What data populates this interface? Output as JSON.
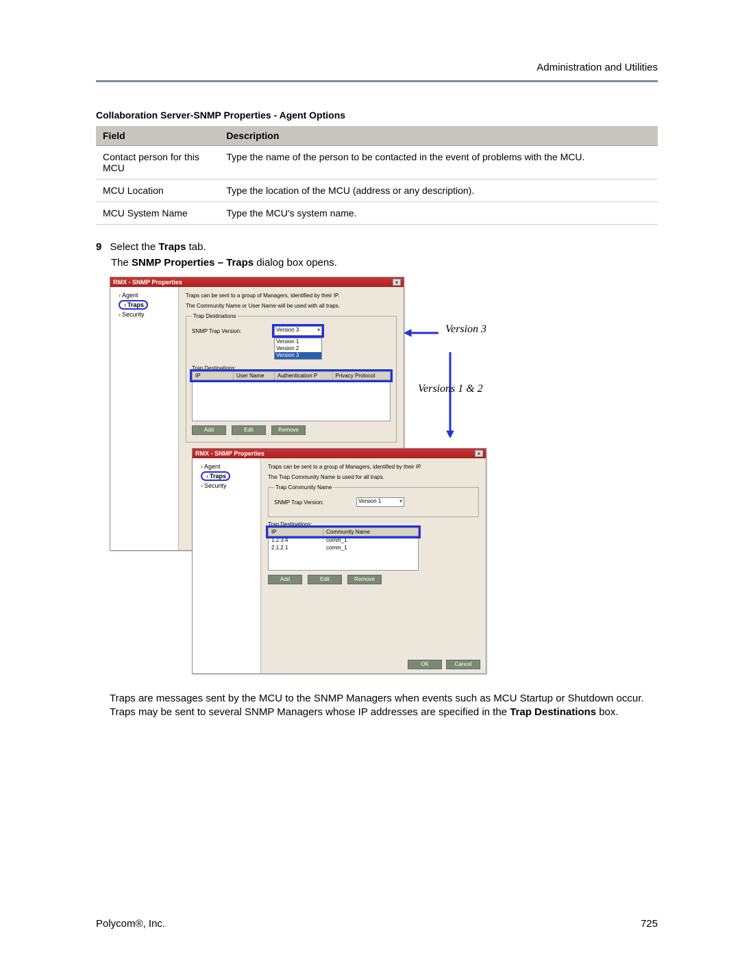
{
  "header": {
    "section": "Administration and Utilities"
  },
  "table": {
    "title": "Collaboration Server-SNMP Properties - Agent Options",
    "cols": {
      "field": "Field",
      "desc": "Description"
    },
    "rows": [
      {
        "field": "Contact person for this MCU",
        "desc": "Type the name of the person to be contacted in the event of problems with the MCU."
      },
      {
        "field": "MCU Location",
        "desc": "Type the location of the MCU (address or any description)."
      },
      {
        "field": "MCU System Name",
        "desc": "Type the MCU's system name."
      }
    ]
  },
  "step": {
    "num": "9",
    "pre": "Select the ",
    "bold": "Traps",
    "post": " tab."
  },
  "step_sub": {
    "pre": "The ",
    "bold": "SNMP Properties – Traps",
    "post": " dialog box opens."
  },
  "win_title": "RMX - SNMP Properties",
  "nav": {
    "agent": "Agent",
    "traps": "Traps",
    "security": "Security"
  },
  "content": {
    "line1": "Traps can be sent to a group of Managers, identified by their IP.",
    "line2_v3": "The Community Name or User Name will be used with all traps.",
    "line2_v1": "The Trap Community Name is used for all traps.",
    "fs_dest": "Trap Destinations",
    "fs_comm": "Trap Community Name",
    "lbl_ver": "SNMP Trap Version:",
    "ver_sel_v3": "Version 3",
    "ver_sel_v1": "Version 1",
    "ver_opts": [
      "Version 1",
      "Version 2",
      "Version 3"
    ],
    "hdr_v3": {
      "ip": "IP",
      "user": "User Name",
      "auth": "Authentication P",
      "priv": "Privacy Protocol"
    },
    "hdr_v1": {
      "ip": "IP",
      "comm": "Community Name"
    },
    "rows_v1": [
      {
        "ip": "1.2.3.4",
        "comm": "comm_1"
      },
      {
        "ip": "2.1.2.1",
        "comm": "comm_1"
      }
    ],
    "btn": {
      "add": "Add",
      "edit": "Edit",
      "remove": "Remove",
      "ok": "OK",
      "cancel": "Cancel"
    }
  },
  "annot": {
    "v3": "Version 3",
    "v12": "Versions 1 & 2"
  },
  "para": {
    "t1": "Traps are messages sent by the MCU to the SNMP Managers when events such as MCU Startup or Shutdown occur. Traps may be sent to several SNMP Managers whose IP addresses are specified in the ",
    "b1": "Trap Destinations",
    "t2": " box."
  },
  "footer": {
    "company": "Polycom®, Inc.",
    "page": "725"
  }
}
